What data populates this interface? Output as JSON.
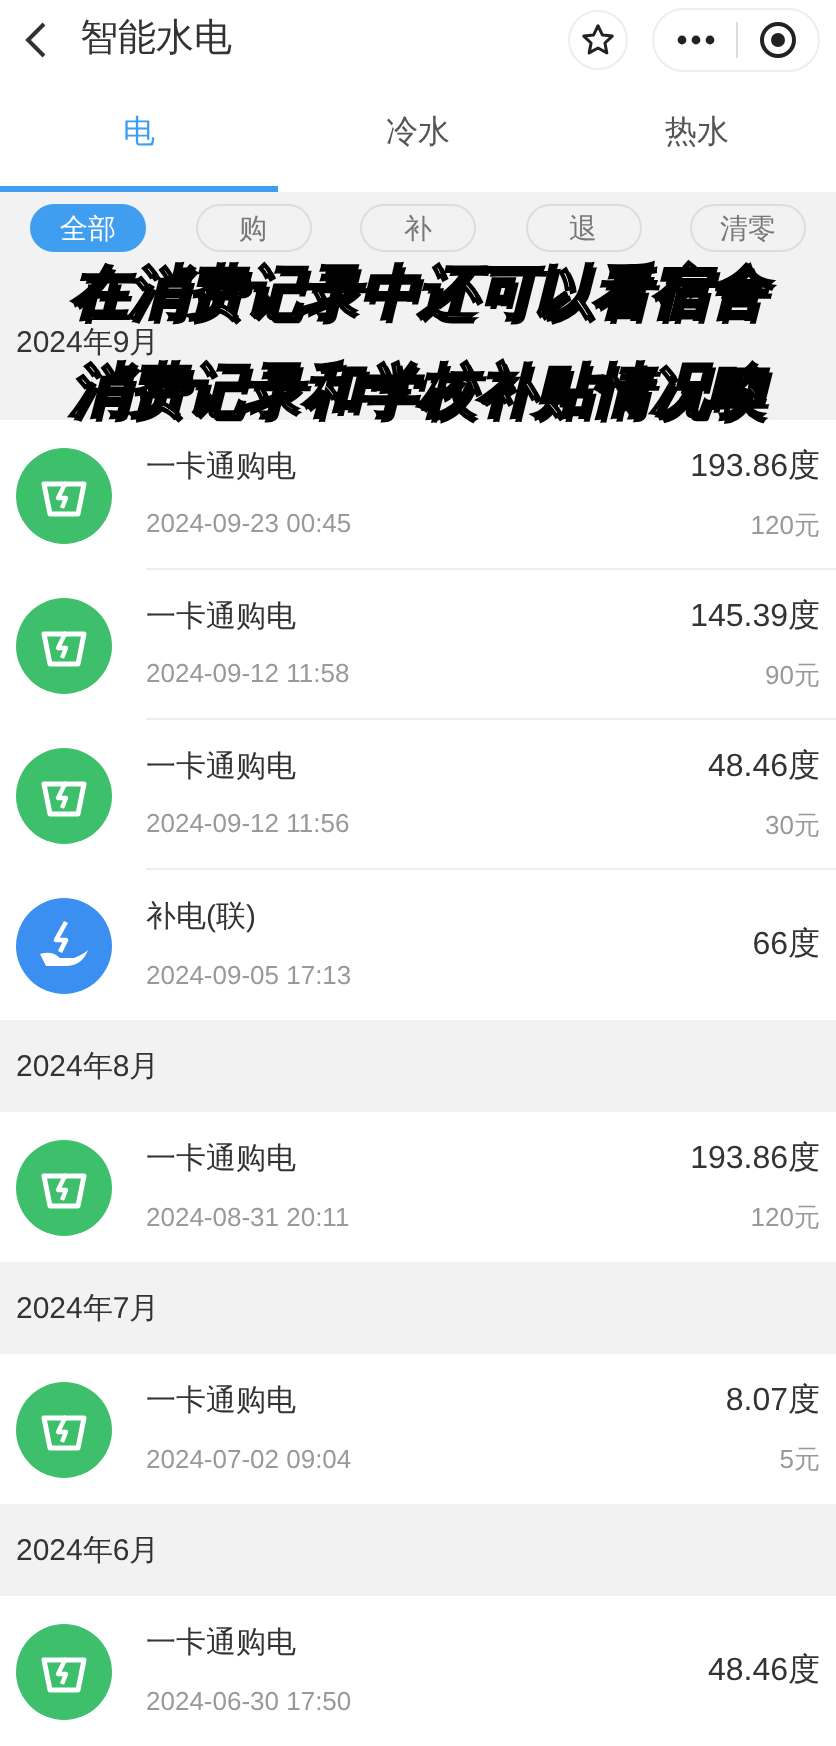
{
  "header": {
    "title": "智能水电"
  },
  "tabs": [
    {
      "label": "电",
      "selected": true
    },
    {
      "label": "冷水",
      "selected": false
    },
    {
      "label": "热水",
      "selected": false
    }
  ],
  "filters": [
    {
      "label": "全部",
      "selected": true
    },
    {
      "label": "购",
      "selected": false
    },
    {
      "label": "补",
      "selected": false
    },
    {
      "label": "退",
      "selected": false
    },
    {
      "label": "清零",
      "selected": false
    }
  ],
  "months": [
    {
      "label": "2024年9月",
      "records": [
        {
          "kind": "buy",
          "title": "一卡通购电",
          "time": "2024-09-23 00:45",
          "quantity": "193.86度",
          "amount": "120元"
        },
        {
          "kind": "buy",
          "title": "一卡通购电",
          "time": "2024-09-12 11:58",
          "quantity": "145.39度",
          "amount": "90元"
        },
        {
          "kind": "buy",
          "title": "一卡通购电",
          "time": "2024-09-12 11:56",
          "quantity": "48.46度",
          "amount": "30元"
        },
        {
          "kind": "subsidy",
          "title": "补电(联)",
          "time": "2024-09-05 17:13",
          "quantity": "66度"
        }
      ]
    },
    {
      "label": "2024年8月",
      "records": [
        {
          "kind": "buy",
          "title": "一卡通购电",
          "time": "2024-08-31 20:11",
          "quantity": "193.86度",
          "amount": "120元"
        }
      ]
    },
    {
      "label": "2024年7月",
      "records": [
        {
          "kind": "buy",
          "title": "一卡通购电",
          "time": "2024-07-02 09:04",
          "quantity": "8.07度",
          "amount": "5元"
        }
      ]
    },
    {
      "label": "2024年6月",
      "records": [
        {
          "kind": "buy",
          "title": "一卡通购电",
          "time": "2024-06-30 17:50",
          "quantity": "48.46度"
        }
      ]
    }
  ],
  "caption": {
    "lines": [
      "在消费记录中还可以看宿舍",
      "消费记录和学校补贴情况噢"
    ]
  }
}
